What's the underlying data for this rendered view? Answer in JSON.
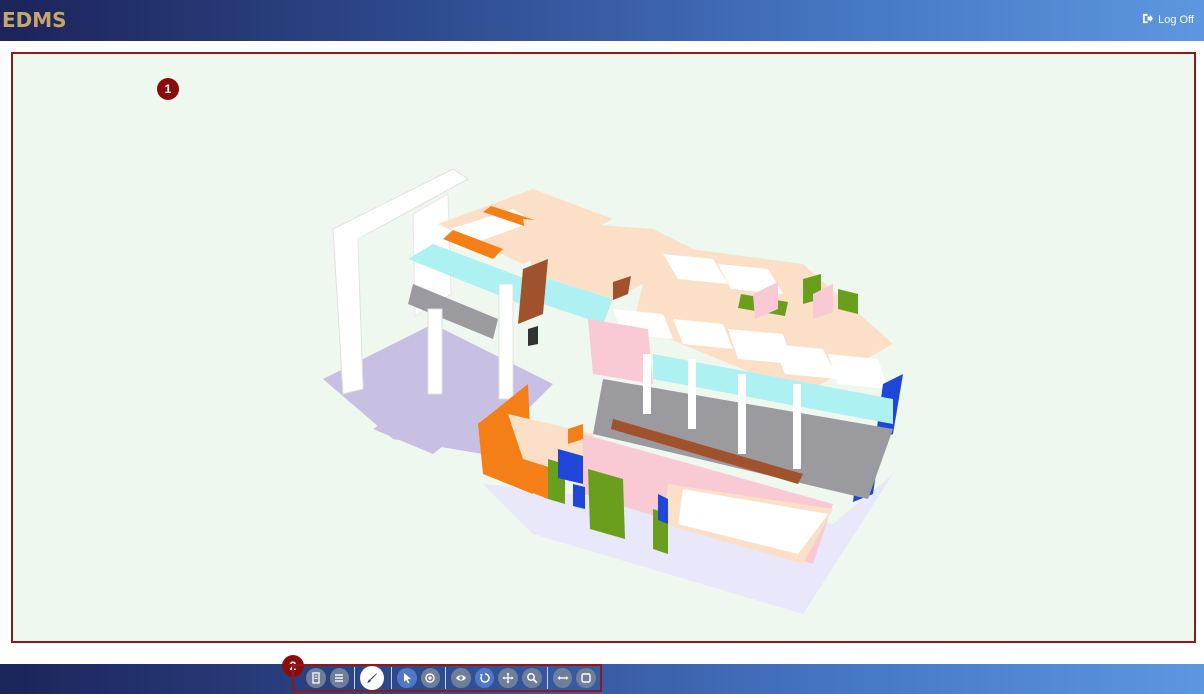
{
  "header": {
    "logo": "EDMS",
    "logoff_label": "Log Off"
  },
  "viewer": {
    "badge": "1"
  },
  "toolbar": {
    "badge": "2",
    "buttons": [
      {
        "name": "model-browser-icon"
      },
      {
        "name": "list-icon"
      },
      {
        "name": "paint-brush-icon"
      },
      {
        "name": "select-pointer-icon"
      },
      {
        "name": "target-icon"
      },
      {
        "name": "eye-icon"
      },
      {
        "name": "rotate-icon"
      },
      {
        "name": "pan-move-icon"
      },
      {
        "name": "zoom-search-icon"
      },
      {
        "name": "measure-icon"
      },
      {
        "name": "section-box-icon"
      }
    ]
  },
  "colors": {
    "accent": "#8b1a1a",
    "viewer_bg": "#eef8ee",
    "logo": "#c8a56a"
  }
}
